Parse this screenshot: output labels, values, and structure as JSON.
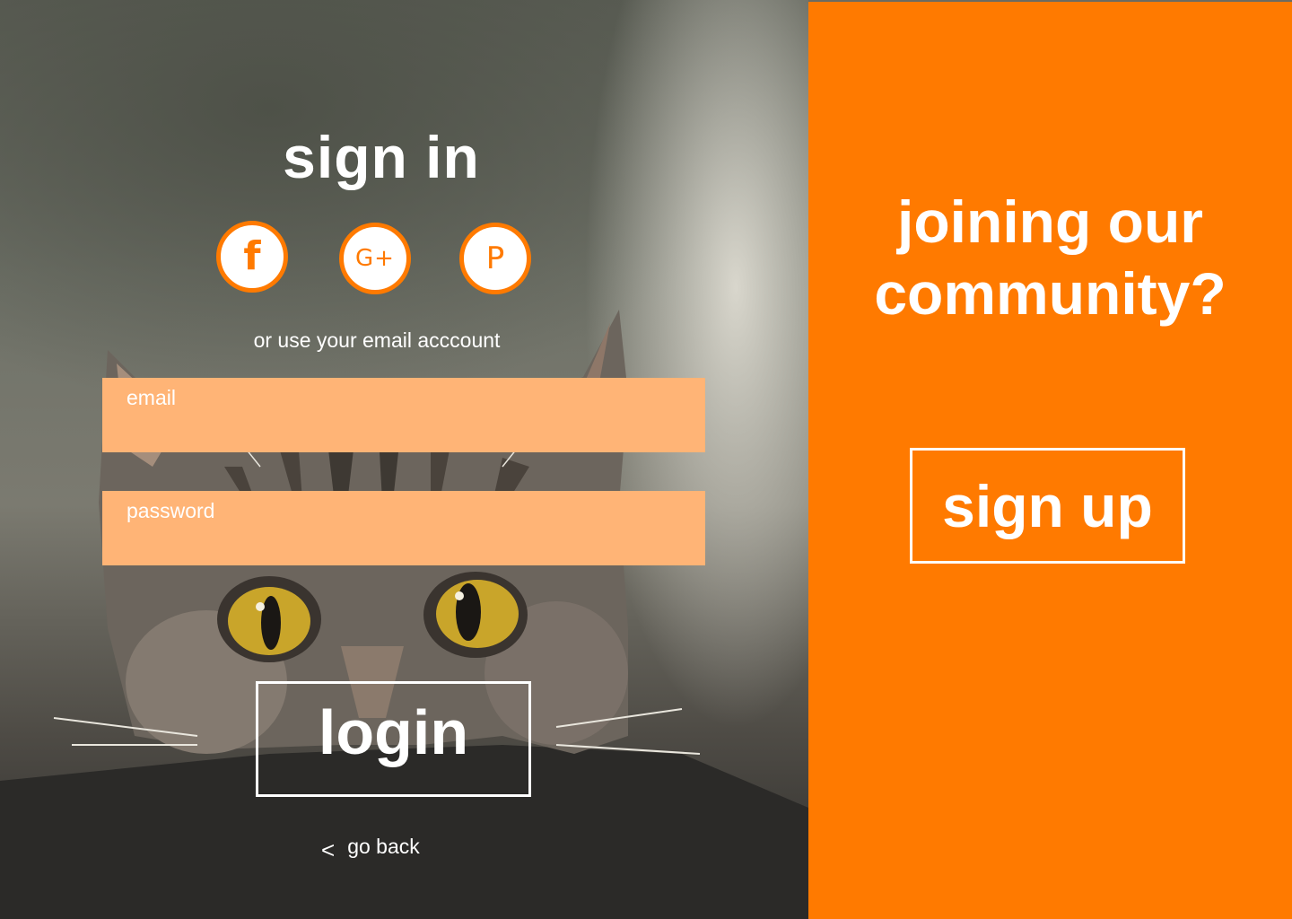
{
  "brand_colors": {
    "accent": "#ff7a00",
    "field_background": "#ffb476",
    "text": "#ffffff"
  },
  "signin": {
    "title": "sign in",
    "social": [
      {
        "icon": "facebook-icon",
        "glyph": "f"
      },
      {
        "icon": "google-plus-icon",
        "glyph": "G+"
      },
      {
        "icon": "pinterest-icon",
        "glyph": "P"
      }
    ],
    "alt_text": "or use your email acccount",
    "email": {
      "label": "email",
      "value": ""
    },
    "password": {
      "label": "password",
      "value": ""
    },
    "login_label": "login",
    "go_back_label": "go back"
  },
  "signup_panel": {
    "heading_line1": "joining our",
    "heading_line2": "community?",
    "signup_label": "sign up"
  }
}
